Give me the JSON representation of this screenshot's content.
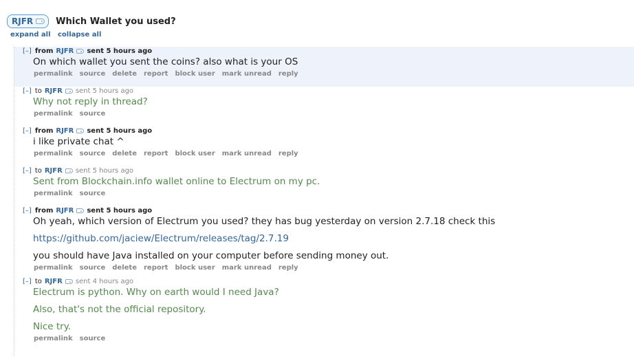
{
  "header": {
    "user": "RJFR",
    "subject": "Which Wallet you used?"
  },
  "controls": {
    "expand_all": "expand all",
    "collapse_all": "collapse all"
  },
  "messages": [
    {
      "toggle": "[–]",
      "direction": "from",
      "author": "RJFR",
      "sent": "sent 5 hours ago",
      "lines": [
        "On which wallet you sent the coins? also what is your OS"
      ],
      "buttons": [
        "permalink",
        "source",
        "delete",
        "report",
        "block user",
        "mark unread",
        "reply"
      ]
    },
    {
      "toggle": "[–]",
      "direction": "to",
      "author": "RJFR",
      "sent": "sent 5 hours ago",
      "lines": [
        "Why not reply in thread?"
      ],
      "buttons": [
        "permalink",
        "source"
      ]
    },
    {
      "toggle": "[–]",
      "direction": "from",
      "author": "RJFR",
      "sent": "sent 5 hours ago",
      "lines": [
        "i like private chat ^"
      ],
      "buttons": [
        "permalink",
        "source",
        "delete",
        "report",
        "block user",
        "mark unread",
        "reply"
      ]
    },
    {
      "toggle": "[–]",
      "direction": "to",
      "author": "RJFR",
      "sent": "sent 5 hours ago",
      "lines": [
        "Sent from Blockchain.info wallet online to Electrum on my pc."
      ],
      "buttons": [
        "permalink",
        "source"
      ]
    },
    {
      "toggle": "[–]",
      "direction": "from",
      "author": "RJFR",
      "sent": "sent 5 hours ago",
      "lines": [
        "Oh yeah, which version of Electrum you used? they has bug yesterday on version 2.7.18 check this",
        "https://github.com/jaciew/Electrum/releases/tag/2.7.19",
        "you should have Java installed on your computer before sending money out."
      ],
      "buttons": [
        "permalink",
        "source",
        "delete",
        "report",
        "block user",
        "mark unread",
        "reply"
      ]
    },
    {
      "toggle": "[–]",
      "direction": "to",
      "author": "RJFR",
      "sent": "sent 4 hours ago",
      "lines": [
        "Electrum is python. Why on earth would I need Java?",
        "Also, that's not the official repository.",
        "Nice try."
      ],
      "buttons": [
        "permalink",
        "source"
      ]
    }
  ]
}
